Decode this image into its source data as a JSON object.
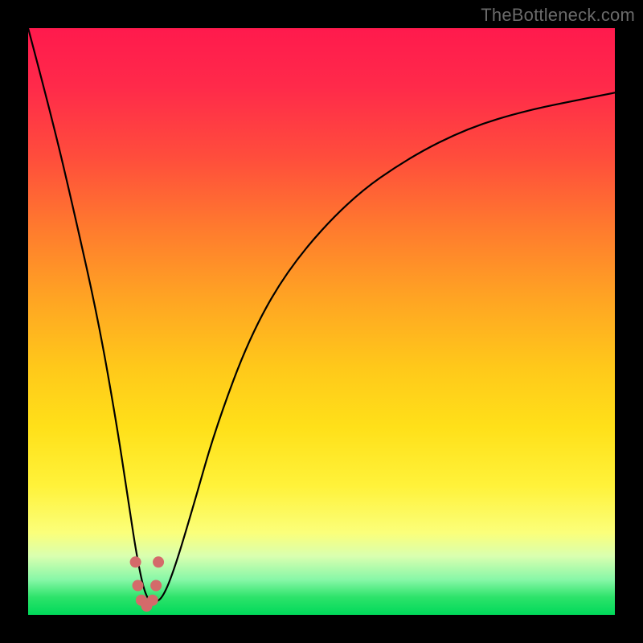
{
  "watermark": "TheBottleneck.com",
  "chart_data": {
    "type": "line",
    "title": "",
    "xlabel": "",
    "ylabel": "",
    "xlim": [
      0,
      100
    ],
    "ylim": [
      0,
      100
    ],
    "series": [
      {
        "name": "bottleneck-curve",
        "x": [
          0,
          4,
          8,
          12,
          15,
          17,
          18.5,
          20,
          21.5,
          23,
          25,
          28,
          32,
          38,
          45,
          55,
          65,
          75,
          85,
          95,
          100
        ],
        "values": [
          100,
          85,
          68,
          50,
          33,
          20,
          10,
          3,
          2,
          3,
          8,
          18,
          32,
          48,
          60,
          71,
          78,
          83,
          86,
          88,
          89
        ]
      }
    ],
    "markers": {
      "color": "#d46a6a",
      "radius_px": 7,
      "points_xy": [
        [
          18.3,
          9
        ],
        [
          18.7,
          5
        ],
        [
          19.3,
          2.5
        ],
        [
          20.2,
          1.5
        ],
        [
          21.2,
          2.5
        ],
        [
          21.8,
          5
        ],
        [
          22.2,
          9
        ]
      ]
    }
  }
}
